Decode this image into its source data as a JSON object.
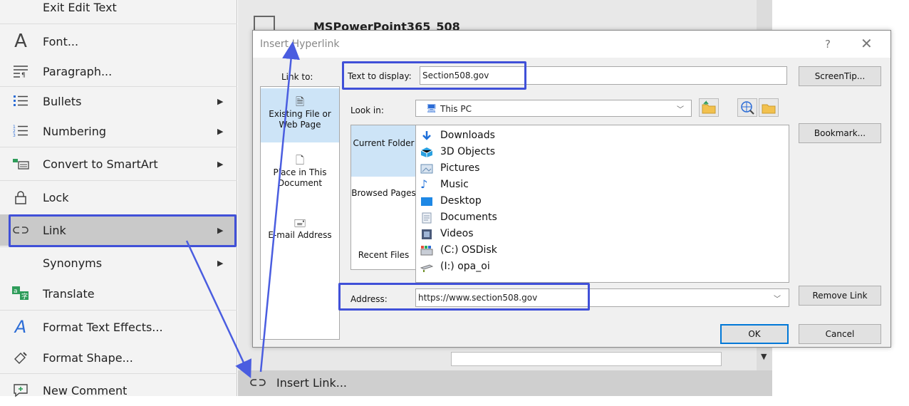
{
  "context_menu": {
    "items": [
      {
        "label": "Exit Edit Text"
      },
      {
        "label": "Font...",
        "icon": "font-icon"
      },
      {
        "label": "Paragraph...",
        "icon": "paragraph-icon"
      },
      {
        "label": "Bullets",
        "icon": "bullets-icon",
        "submenu": true
      },
      {
        "label": "Numbering",
        "icon": "numbering-icon",
        "submenu": true
      },
      {
        "label": "Convert to SmartArt",
        "icon": "smartart-icon",
        "submenu": true
      },
      {
        "label": "Lock",
        "icon": "lock-icon"
      },
      {
        "label": "Link",
        "icon": "link-icon",
        "submenu": true,
        "highlighted": true
      },
      {
        "label": "Synonyms",
        "submenu": true
      },
      {
        "label": "Translate",
        "icon": "translate-icon"
      },
      {
        "label": "Format Text Effects...",
        "icon": "text-effects-icon"
      },
      {
        "label": "Format Shape...",
        "icon": "format-shape-icon"
      },
      {
        "label": "New Comment",
        "icon": "comment-icon"
      }
    ]
  },
  "document": {
    "title": "MSPowerPoint365_508",
    "insert_link_label": "Insert Link..."
  },
  "dialog": {
    "title": "Insert Hyperlink",
    "help": "?",
    "close": "✕",
    "link_to_label": "Link to:",
    "link_to_options": [
      {
        "label": "Existing File or Web Page",
        "icon": "web-page-icon",
        "selected": true
      },
      {
        "label": "Place in This Document",
        "icon": "place-in-document-icon"
      },
      {
        "label": "E-mail Address",
        "icon": "email-icon"
      }
    ],
    "text_to_display_label": "Text to display:",
    "text_to_display_value": "Section508.gov",
    "screentip_button": "ScreenTip...",
    "look_in_label": "Look in:",
    "look_in_value": "This PC",
    "nav": [
      {
        "label": "Current Folder",
        "selected": true
      },
      {
        "label": "Browsed Pages"
      },
      {
        "label": "Recent Files"
      }
    ],
    "files": [
      {
        "name": "Downloads",
        "icon": "download-icon",
        "color": "#1e6fd9"
      },
      {
        "name": "3D Objects",
        "icon": "3d-objects-icon",
        "color": "#2aa0e0"
      },
      {
        "name": "Pictures",
        "icon": "pictures-icon",
        "color": "#6a8fb5"
      },
      {
        "name": "Music",
        "icon": "music-icon",
        "color": "#1e6fd9"
      },
      {
        "name": "Desktop",
        "icon": "desktop-icon",
        "color": "#1e88e5"
      },
      {
        "name": "Documents",
        "icon": "documents-icon",
        "color": "#8a9bb0"
      },
      {
        "name": "Videos",
        "icon": "videos-icon",
        "color": "#4a5a7a"
      },
      {
        "name": "(C:) OSDisk",
        "icon": "disk-icon",
        "color": "#4a7fd0"
      },
      {
        "name": "(I:) opa_oi",
        "icon": "network-drive-icon",
        "color": "#6b8e23"
      }
    ],
    "bookmark_button": "Bookmark...",
    "address_label": "Address:",
    "address_value": "https://www.section508.gov",
    "remove_link_button": "Remove Link",
    "ok_button": "OK",
    "cancel_button": "Cancel"
  },
  "colors": {
    "highlight": "#4050d8",
    "selection": "#cde4f7",
    "primary_border": "#0078d7"
  }
}
